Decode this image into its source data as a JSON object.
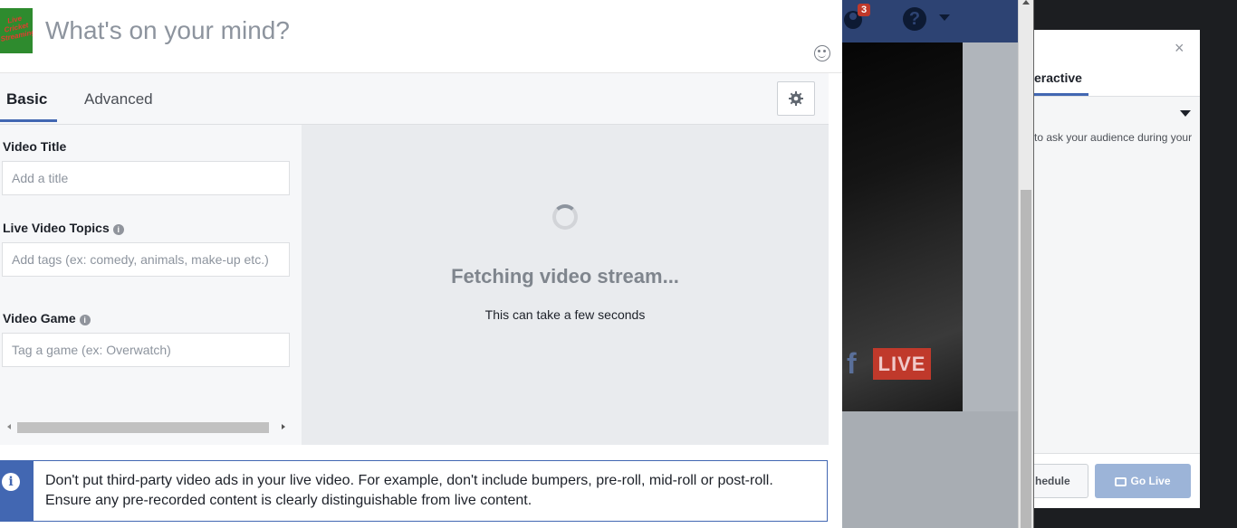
{
  "composer": {
    "avatar_text": "Live Cricket Streaming",
    "prompt": "What's on your mind?"
  },
  "tabs": {
    "basic": "Basic",
    "advanced": "Advanced"
  },
  "form": {
    "video_title_label": "Video Title",
    "video_title_placeholder": "Add a title",
    "topics_label": "Live Video Topics",
    "topics_placeholder": "Add tags (ex: comedy, animals, make-up etc.)",
    "game_label": "Video Game",
    "game_placeholder": "Tag a game (ex: Overwatch)",
    "info_glyph": "i"
  },
  "preview": {
    "status": "Fetching video stream...",
    "hint": "This can take a few seconds"
  },
  "notice": {
    "text": "Don't put third-party video ads in your live video. For example, don't include bumpers, pre-roll, mid-roll or post-roll. Ensure any pre-recorded content is clearly distinguishable from live content.",
    "icon_glyph": "i"
  },
  "background": {
    "notification_count": "3",
    "help_glyph": "?",
    "fb_glyph": "f",
    "live_badge": "LIVE"
  },
  "right_panel": {
    "close_glyph": "×",
    "tab_label": "eractive",
    "description": "to ask your audience during your",
    "schedule_label": "hedule",
    "go_live_label": "Go Live"
  },
  "colors": {
    "accent": "#4267b2",
    "live_red": "#c0392b",
    "go_live_disabled": "#9cb4d8"
  }
}
